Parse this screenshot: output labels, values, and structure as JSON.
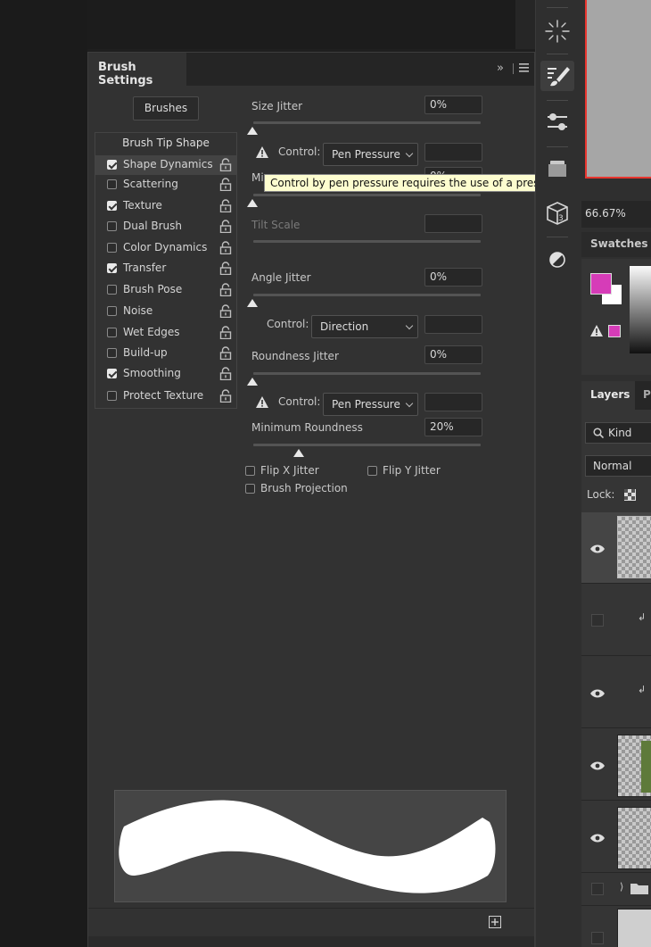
{
  "panel": {
    "title": "Brush Settings",
    "brushes_button": "Brushes",
    "category_header": "Brush Tip Shape",
    "categories": [
      {
        "label": "Shape Dynamics",
        "checked": true,
        "selected": true
      },
      {
        "label": "Scattering",
        "checked": false
      },
      {
        "label": "Texture",
        "checked": true
      },
      {
        "label": "Dual Brush",
        "checked": false
      },
      {
        "label": "Color Dynamics",
        "checked": false
      },
      {
        "label": "Transfer",
        "checked": true
      },
      {
        "label": "Brush Pose",
        "checked": false
      },
      {
        "label": "Noise",
        "checked": false
      },
      {
        "label": "Wet Edges",
        "checked": false
      },
      {
        "label": "Build-up",
        "checked": false
      },
      {
        "label": "Smoothing",
        "checked": true
      },
      {
        "label": "Protect Texture",
        "checked": false
      }
    ]
  },
  "controls": {
    "size_jitter_label": "Size Jitter",
    "size_jitter_value": "0%",
    "control_label": "Control:",
    "size_control": "Pen Pressure",
    "min_diameter_label": "Mi",
    "min_diameter_value": "0%",
    "tilt_scale_label": "Tilt Scale",
    "angle_jitter_label": "Angle Jitter",
    "angle_jitter_value": "0%",
    "angle_control": "Direction",
    "roundness_jitter_label": "Roundness Jitter",
    "roundness_jitter_value": "0%",
    "roundness_control": "Pen Pressure",
    "min_roundness_label": "Minimum Roundness",
    "min_roundness_value": "20%",
    "min_roundness_level": 0.2,
    "flip_x": "Flip X Jitter",
    "flip_y": "Flip Y Jitter",
    "brush_projection": "Brush Projection"
  },
  "tooltip": "Control by pen pressure requires the use of a pressure sensitive tablet",
  "dock": {
    "zoom": "66.67%",
    "swatches_title": "Swatches",
    "foreground_color": "#d63cb8",
    "layers_tab": "Layers",
    "paths_tab": "Pa",
    "kind_filter": "Kind",
    "blend_mode": "Normal",
    "lock_label": "Lock:"
  },
  "colors": {
    "accent_red": "#e8352f",
    "warning_icon": "#e0e0e0"
  }
}
